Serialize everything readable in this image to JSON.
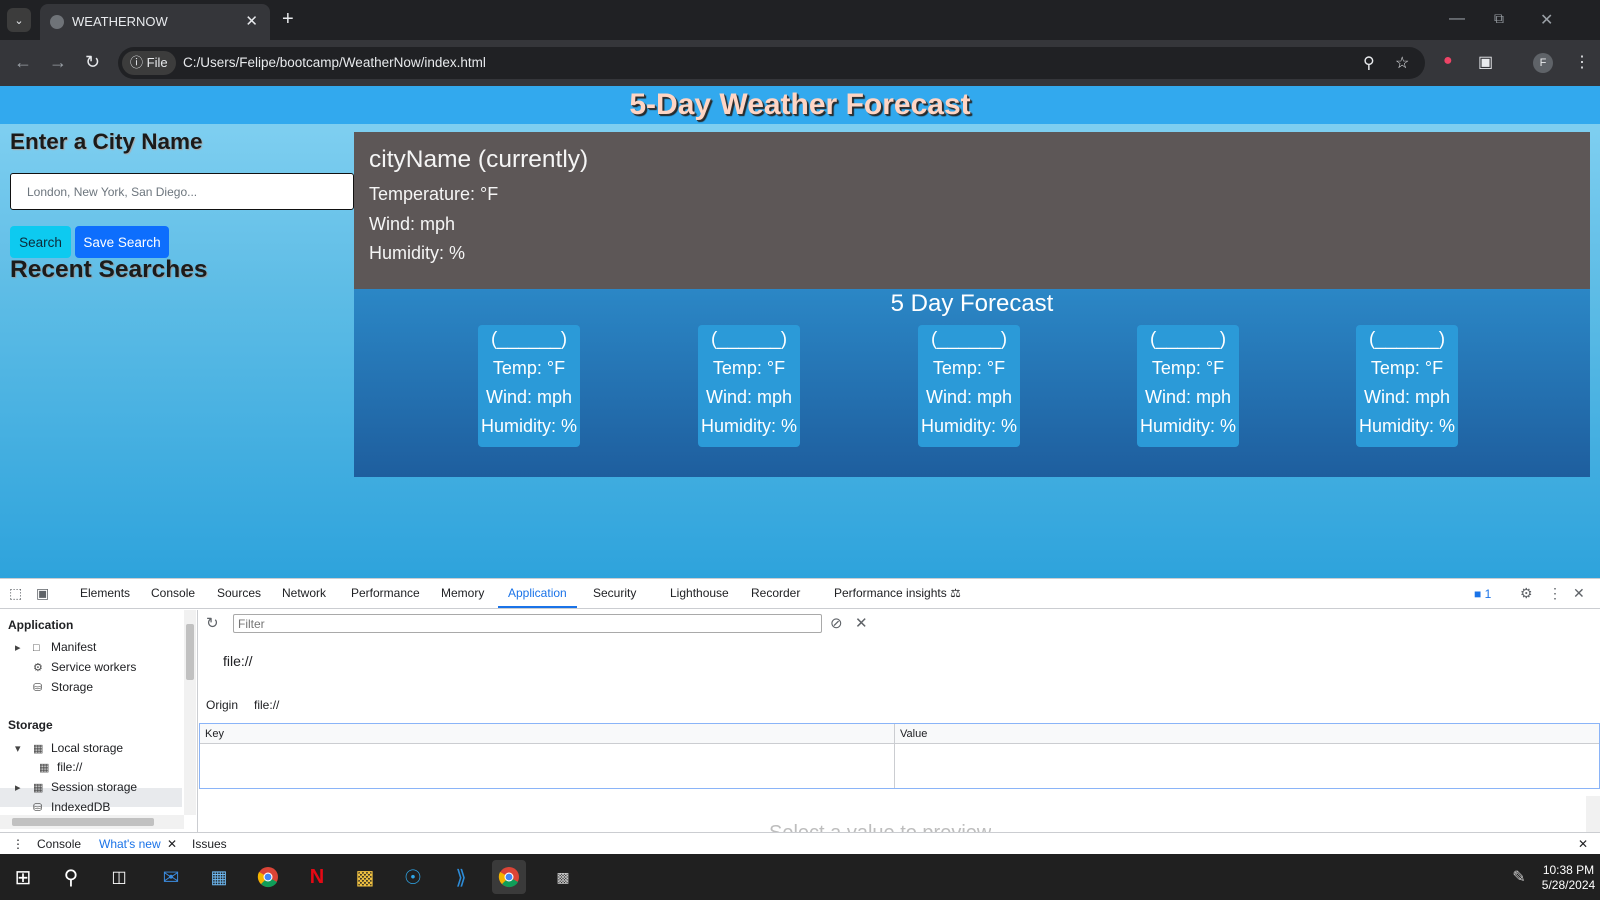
{
  "browser": {
    "tab_title": "WEATHERNOW",
    "site_chip": "File",
    "url": "C:/Users/Felipe/bootcamp/WeatherNow/index.html",
    "profile_initial": "F"
  },
  "page": {
    "title": "5-Day Weather Forecast",
    "search_heading": "Enter a City Name",
    "search_placeholder": "London, New York, San Diego...",
    "search_button": "Search",
    "save_button": "Save Search",
    "recent_heading": "Recent Searches",
    "current": {
      "city": "cityName (currently)",
      "temperature": "Temperature: °F",
      "wind": "Wind: mph",
      "humidity": "Humidity: %"
    },
    "forecast_heading": "5 Day Forecast",
    "forecast": [
      {
        "date": "(______)",
        "temp": "Temp: °F",
        "wind": "Wind: mph",
        "humidity": "Humidity: %"
      },
      {
        "date": "(______)",
        "temp": "Temp: °F",
        "wind": "Wind: mph",
        "humidity": "Humidity: %"
      },
      {
        "date": "(______)",
        "temp": "Temp: °F",
        "wind": "Wind: mph",
        "humidity": "Humidity: %"
      },
      {
        "date": "(______)",
        "temp": "Temp: °F",
        "wind": "Wind: mph",
        "humidity": "Humidity: %"
      },
      {
        "date": "(______)",
        "temp": "Temp: °F",
        "wind": "Wind: mph",
        "humidity": "Humidity: %"
      }
    ]
  },
  "devtools": {
    "tabs": [
      "Elements",
      "Console",
      "Sources",
      "Network",
      "Performance",
      "Memory",
      "Application",
      "Security",
      "Lighthouse",
      "Recorder",
      "Performance insights"
    ],
    "active_tab": "Application",
    "issues_count": "1",
    "sidebar": {
      "application_heading": "Application",
      "manifest": "Manifest",
      "service_workers": "Service workers",
      "storage": "Storage",
      "storage_heading": "Storage",
      "local_storage": "Local storage",
      "local_file": "file://",
      "session_storage": "Session storage",
      "indexeddb": "IndexedDB"
    },
    "filter_placeholder": "Filter",
    "origin_title": "file://",
    "origin_label": "Origin",
    "origin_value": "file://",
    "key_header": "Key",
    "value_header": "Value",
    "ghost_text": "Select a value to preview",
    "drawer": {
      "console": "Console",
      "whats_new": "What's new",
      "issues": "Issues"
    }
  },
  "taskbar": {
    "time": "10:38 PM",
    "date": "5/28/2024"
  }
}
